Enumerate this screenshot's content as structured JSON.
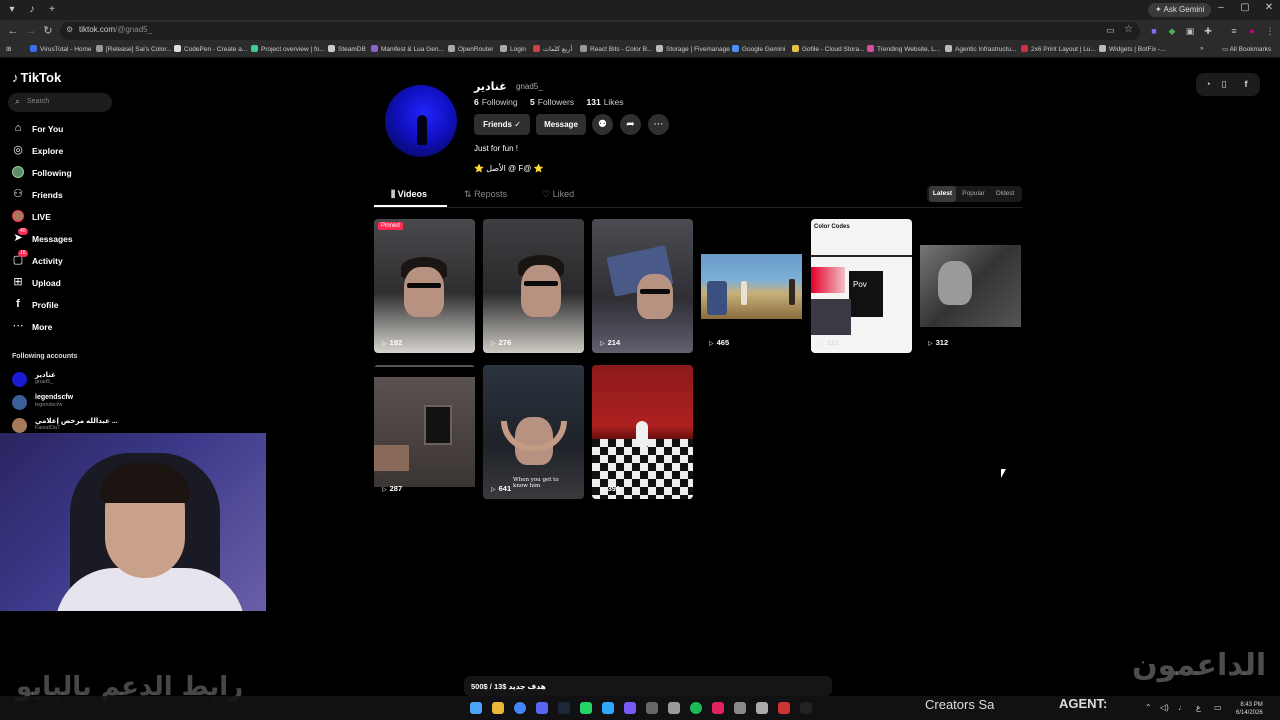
{
  "browser": {
    "url_domain": "tiktok.com",
    "url_path": "/@gnad5_",
    "ask_gemini": "Ask Gemini",
    "bookmarks": [
      {
        "label": "VirusTotal - Home",
        "color": "#3b6ee8"
      },
      {
        "label": "[Release] Sai's Color...",
        "color": "#999999"
      },
      {
        "label": "CodePen - Create a...",
        "color": "#dddddd"
      },
      {
        "label": "Project overview | fo...",
        "color": "#3ecf8e"
      },
      {
        "label": "SteamDB",
        "color": "#cccccc"
      },
      {
        "label": "Manifest & Lua Gen...",
        "color": "#8866cc"
      },
      {
        "label": "OpenRouter",
        "color": "#aaaaaa"
      },
      {
        "label": "Login",
        "color": "#aaaaaa"
      },
      {
        "label": "أربع كلمات",
        "color": "#cc4444"
      },
      {
        "label": "React Bits - Color B...",
        "color": "#999999"
      },
      {
        "label": "Storage | Fivemanage",
        "color": "#bbbbbb"
      },
      {
        "label": "Google Gemini",
        "color": "#4e8ef7"
      },
      {
        "label": "Gofile - Cloud Stora...",
        "color": "#e6c14a"
      },
      {
        "label": "Trending Website, L...",
        "color": "#d14ea0"
      },
      {
        "label": "Agentic Infrastructu...",
        "color": "#bbbbbb"
      },
      {
        "label": "2x6 Print Layout | Lu...",
        "color": "#cc3344"
      },
      {
        "label": "Widgets | BotFix -...",
        "color": "#bbbbbb"
      }
    ],
    "all_bookmarks": "All Bookmarks"
  },
  "sidebar": {
    "logo": "TikTok",
    "search_placeholder": "Search",
    "items": [
      {
        "label": "For You",
        "icon": "home-icon"
      },
      {
        "label": "Explore",
        "icon": "compass-icon"
      },
      {
        "label": "Following",
        "icon": "following-avatar"
      },
      {
        "label": "Friends",
        "icon": "friends-icon"
      },
      {
        "label": "LIVE",
        "icon": "live-avatar"
      },
      {
        "label": "Messages",
        "icon": "messages-icon",
        "badge": "40"
      },
      {
        "label": "Activity",
        "icon": "activity-icon",
        "badge": "16"
      },
      {
        "label": "Upload",
        "icon": "upload-icon"
      },
      {
        "label": "Profile",
        "icon": "profile-icon"
      },
      {
        "label": "More",
        "icon": "more-icon"
      }
    ],
    "following_title": "Following accounts",
    "accounts": [
      {
        "name": "غنادير",
        "handle": "gnad5_",
        "color": "#1b1bd6"
      },
      {
        "name": "legendscfw",
        "handle": "legendscfw",
        "color": "#3a5f99"
      },
      {
        "name": "عبدالله مرخص إعلامي ...",
        "handle": "FaisalOa7",
        "color": "#a67b5b"
      }
    ]
  },
  "profile": {
    "name": "غنادير",
    "handle": "gnad5_",
    "following_count": "6",
    "following_label": "Following",
    "followers_count": "5",
    "followers_label": "Followers",
    "likes_count": "131",
    "likes_label": "Likes",
    "friends_button": "Friends",
    "message_button": "Message",
    "bio": "Just for fun !",
    "bio_line2": "⭐ الأصل @ F@ ⭐"
  },
  "tabs": {
    "videos": "Videos",
    "reposts": "Reposts",
    "liked": "Liked"
  },
  "sort": [
    "Latest",
    "Popular",
    "Oldest"
  ],
  "videos": [
    {
      "views": "192",
      "pinned": "Pinned"
    },
    {
      "views": "276"
    },
    {
      "views": "214"
    },
    {
      "views": "465"
    },
    {
      "views": "113",
      "title": "Color Codes",
      "overlay": "Pov"
    },
    {
      "views": "312"
    },
    {
      "views": "287"
    },
    {
      "views": "641",
      "caption": "When you get to know him"
    },
    {
      "views": "391"
    }
  ],
  "overlay": {
    "watermark_left": "رابط الدعم بالبايو",
    "watermark_right": "الداعمون",
    "goal": "هدف جديد  $13 / $500",
    "creators": "Creators Sa",
    "agent": "AGENT:"
  },
  "taskbar": {
    "time": "8:43 PM",
    "date": "6/14/2026",
    "lang": "ع"
  }
}
